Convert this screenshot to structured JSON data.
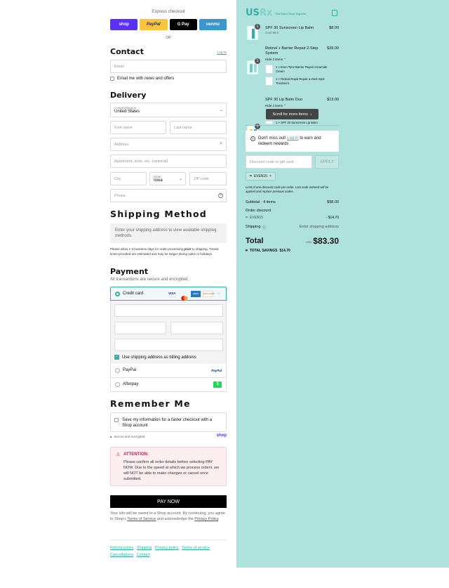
{
  "express": {
    "title": "Express checkout",
    "buttons": [
      "shop",
      "PayPal",
      "G Pay",
      "venmo"
    ],
    "or": "OR"
  },
  "contact": {
    "title": "Contact",
    "login": "Log in",
    "email_placeholder": "Email",
    "newsletter": "Email me with news and offers"
  },
  "delivery": {
    "title": "Delivery",
    "country_label": "Country/Region",
    "country": "United States",
    "first_name": "First name",
    "last_name": "Last name",
    "address": "Address",
    "apartment": "Apartment, suite, etc. (optional)",
    "city": "City",
    "state_label": "State",
    "state": "Iowa",
    "zip": "ZIP code",
    "phone": "Phone"
  },
  "shipping": {
    "title": "Shipping Method",
    "notice": "Enter your shipping address to view available shipping methods.",
    "note_a": "Please allow 1-3 business days for order processing ",
    "note_em": "prior",
    "note_b": " to shipping. Transit times provided are estimated and may be longer during sales or holidays."
  },
  "payment": {
    "title": "Payment",
    "subtitle": "All transactions are secure and encrypted.",
    "credit_card": "Credit card",
    "card_brands": [
      "VISA",
      "MC",
      "AMEX",
      "DISCOVER"
    ],
    "billing_same": "Use shipping address as billing address",
    "paypal": "PayPal",
    "paypal_logo": "PayPal",
    "afterpay": "Afterpay",
    "afterpay_logo": "$"
  },
  "remember": {
    "title": "Remember Me",
    "save_info": "Save my information for a faster checkout with a Shop account",
    "secure": "Secure and encrypted",
    "shop": "shop"
  },
  "attention": {
    "title": "ATTENTION:",
    "body": "Please confirm all order details before selecting PAY NOW. Due to the speed at which we process orders, we will NOT be able to make changes or cancel once submitted."
  },
  "pay_now": "PAY NOW",
  "legal": {
    "text_a": "Your info will be saved to a Shop account. By continuing, you agree to Shop's ",
    "terms": "Terms of Service",
    "text_b": " and acknowledge the ",
    "privacy": "Privacy Policy",
    "text_c": "."
  },
  "footer_links": [
    "Refund policy",
    "Shipping",
    "Privacy policy",
    "Terms of service",
    "Cancellations",
    "Contact"
  ],
  "brand": {
    "logo_a": "US",
    "logo_b": "Rx",
    "tagline": "The Even Tone Experts"
  },
  "cart": {
    "items": [
      {
        "qty": "1",
        "name": "SPF 30 Sunscreen Lip Balm",
        "variant": "Cool Mint",
        "price": "$8.00"
      },
      {
        "qty": "1",
        "name": "Retinol + Barrier Repair 2-Step System",
        "hide": "Hide 2 items",
        "price": "$39.00",
        "subitems": [
          "1 × Even Tone Barrier Repair Ceramide Cream",
          "1 × Retinol Rapid Repair & Dark Spot Treatment"
        ]
      },
      {
        "qty": "1",
        "name": "SPF 30 Lip Balm Duo",
        "hide": "Hide 2 items",
        "price": "$13.00",
        "subitems": [
          "1 × SPF 30 Sunscreen Lip Balm"
        ]
      }
    ],
    "scroll_tip": "Scroll for more items"
  },
  "rewards": {
    "text_a": "Don't miss out! ",
    "login": "Log in",
    "text_b": " to earn and redeem rewards"
  },
  "discount": {
    "placeholder": "Discount code or gift card",
    "apply": "APPLY",
    "code": "EVEN15",
    "notice": "Limit of one discount code per order. Last code entered will be applied and replace previous codes."
  },
  "summary": {
    "subtotal_label": "Subtotal · 4 items",
    "subtotal": "$98.00",
    "order_discount": "Order discount",
    "discount_code": "EVEN15",
    "discount_value": "- $14.70",
    "shipping_label": "Shipping",
    "shipping_value": "Enter shipping address",
    "total_label": "Total",
    "currency": "USD",
    "total": "$83.30",
    "savings_label": "TOTAL SAVINGS",
    "savings": "$14.70"
  },
  "colors": {
    "accent": "#2fb0a6",
    "right_panel": "#b0e2dd",
    "shop_pay": "#5a31f4",
    "paypal": "#ffc439",
    "gpay": "#000000",
    "venmo": "#3d95ce"
  }
}
